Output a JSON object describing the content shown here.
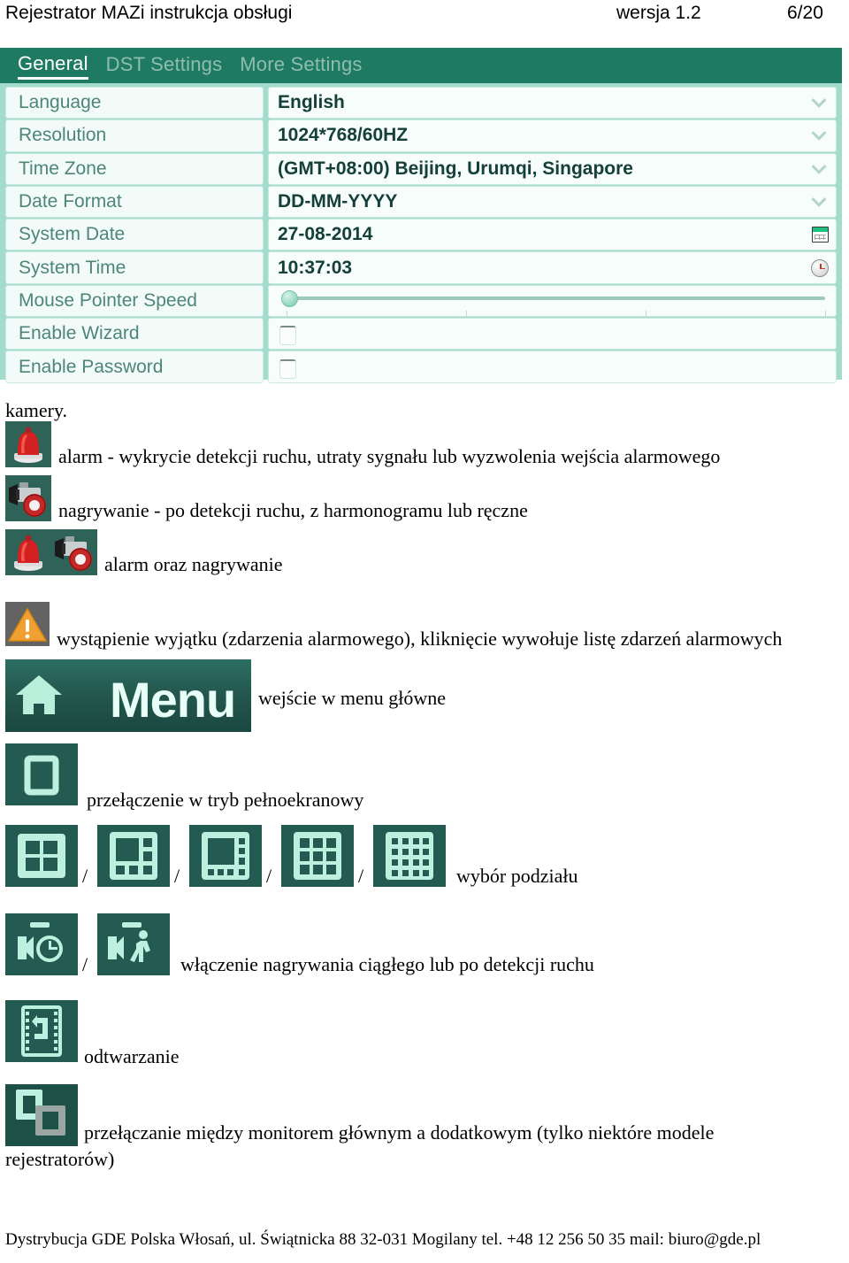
{
  "header": {
    "title": "Rejestrator MAZi instrukcja obsługi",
    "version": "wersja 1.2",
    "page": "6/20"
  },
  "dvr_panel": {
    "tabs": [
      {
        "label": "General",
        "active": true
      },
      {
        "label": "DST Settings",
        "active": false
      },
      {
        "label": "More Settings",
        "active": false
      }
    ],
    "rows": [
      {
        "label": "Language",
        "value": "English",
        "control": "dropdown"
      },
      {
        "label": "Resolution",
        "value": "1024*768/60HZ",
        "control": "dropdown"
      },
      {
        "label": "Time Zone",
        "value": "(GMT+08:00) Beijing, Urumqi, Singapore",
        "control": "dropdown"
      },
      {
        "label": "Date Format",
        "value": "DD-MM-YYYY",
        "control": "dropdown"
      },
      {
        "label": "System Date",
        "value": "27-08-2014",
        "control": "calendar"
      },
      {
        "label": "System Time",
        "value": "10:37:03",
        "control": "clock"
      },
      {
        "label": "Mouse Pointer Speed",
        "value": "",
        "control": "slider"
      },
      {
        "label": "Enable Wizard",
        "value": "",
        "control": "checkbox"
      },
      {
        "label": "Enable Password",
        "value": "",
        "control": "checkbox"
      }
    ],
    "colors": {
      "tab_bar": "#1f7a62",
      "panel_bg": "#a3dccd",
      "label_bg": "#f2fbf8",
      "label_text": "#4e857a",
      "value_text": "#15403a"
    }
  },
  "body": {
    "lead": "kamery.",
    "items": [
      {
        "text": "alarm - wykrycie detekcji ruchu, utraty sygnału lub wyzwolenia wejścia alarmowego"
      },
      {
        "text": "nagrywanie - po detekcji ruchu, z harmonogramu lub ręczne"
      },
      {
        "text": "alarm oraz nagrywanie"
      },
      {
        "text": "wystąpienie wyjątku (zdarzenia alarmowego), kliknięcie wywołuje listę zdarzeń alarmowych"
      },
      {
        "text": "wejście w menu główne"
      },
      {
        "text": "przełączenie w tryb pełnoekranowy"
      },
      {
        "text": "wybór podziału"
      },
      {
        "text": "włączenie nagrywania ciągłego lub po detekcji ruchu"
      },
      {
        "text": "odtwarzanie"
      },
      {
        "text": "przełączanie między monitorem głównym a dodatkowym (tylko niektóre modele"
      },
      {
        "text": "rejestratorów)"
      }
    ],
    "separators": {
      "slash": "/"
    },
    "menu_button_label": "Menu"
  },
  "footer": {
    "text": "Dystrybucja GDE Polska    Włosań, ul. Świątnicka 88 32-031 Mogilany    tel. +48 12 256 50 35 mail: biuro@gde.pl"
  }
}
